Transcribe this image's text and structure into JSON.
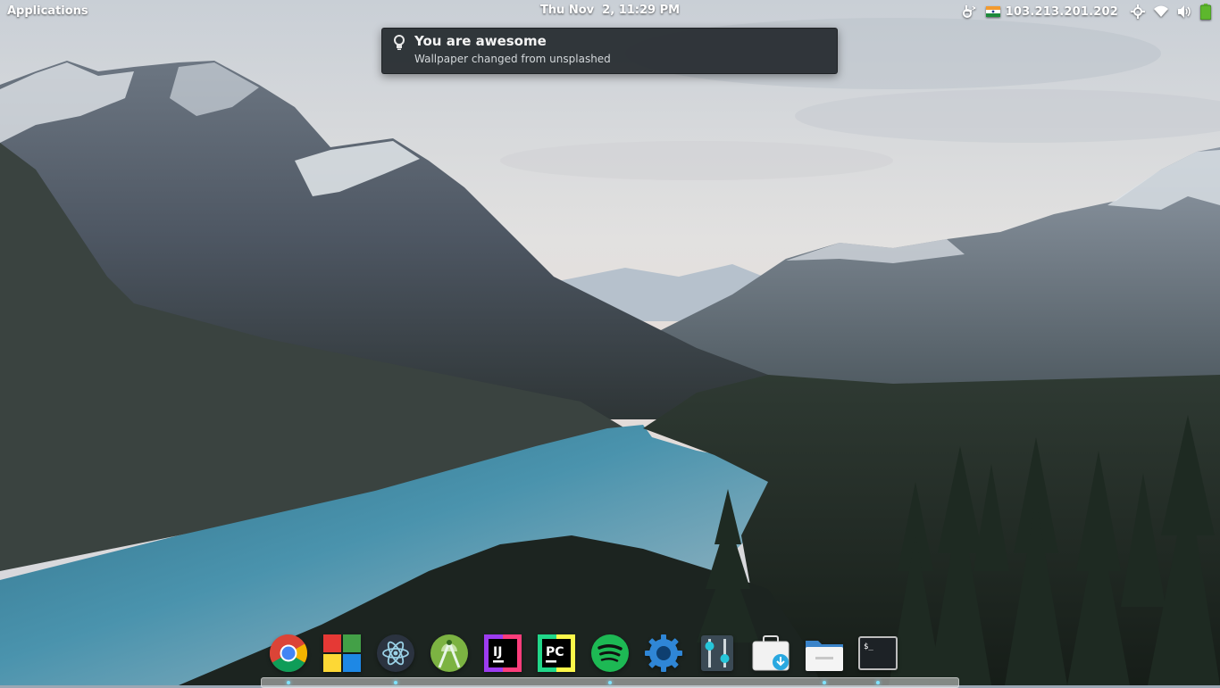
{
  "top_panel": {
    "applications_label": "Applications",
    "clock": "Thu Nov  2, 11:29 PM",
    "ip_address": "103.213.201.202",
    "indicators": [
      "accessibility-icon",
      "india-flag-icon",
      "location-icon",
      "wifi-icon",
      "volume-icon",
      "battery-icon"
    ]
  },
  "notification": {
    "icon": "lightbulb-icon",
    "title": "You are awesome",
    "body": "Wallpaper changed from unsplashed"
  },
  "dock": {
    "items": [
      {
        "icon": "chrome-icon",
        "running": true
      },
      {
        "icon": "app-center-icon",
        "running": false
      },
      {
        "icon": "atom-icon",
        "running": true
      },
      {
        "icon": "android-studio-icon",
        "running": false
      },
      {
        "icon": "intellij-idea-icon",
        "running": false
      },
      {
        "icon": "pycharm-icon",
        "running": true
      },
      {
        "icon": "spotify-icon",
        "running": false
      },
      {
        "icon": "settings-gear-icon",
        "running": false
      },
      {
        "icon": "tweaks-icon",
        "running": false
      },
      {
        "icon": "software-download-icon",
        "running": true
      },
      {
        "icon": "files-icon",
        "running": false
      },
      {
        "icon": "terminal-icon",
        "running": true
      }
    ]
  },
  "colors": {
    "notification_bg": "#262c30",
    "running_indicator": "#7fe3ff",
    "sky": "#d9dde2",
    "lake": "#3f8aa6"
  }
}
